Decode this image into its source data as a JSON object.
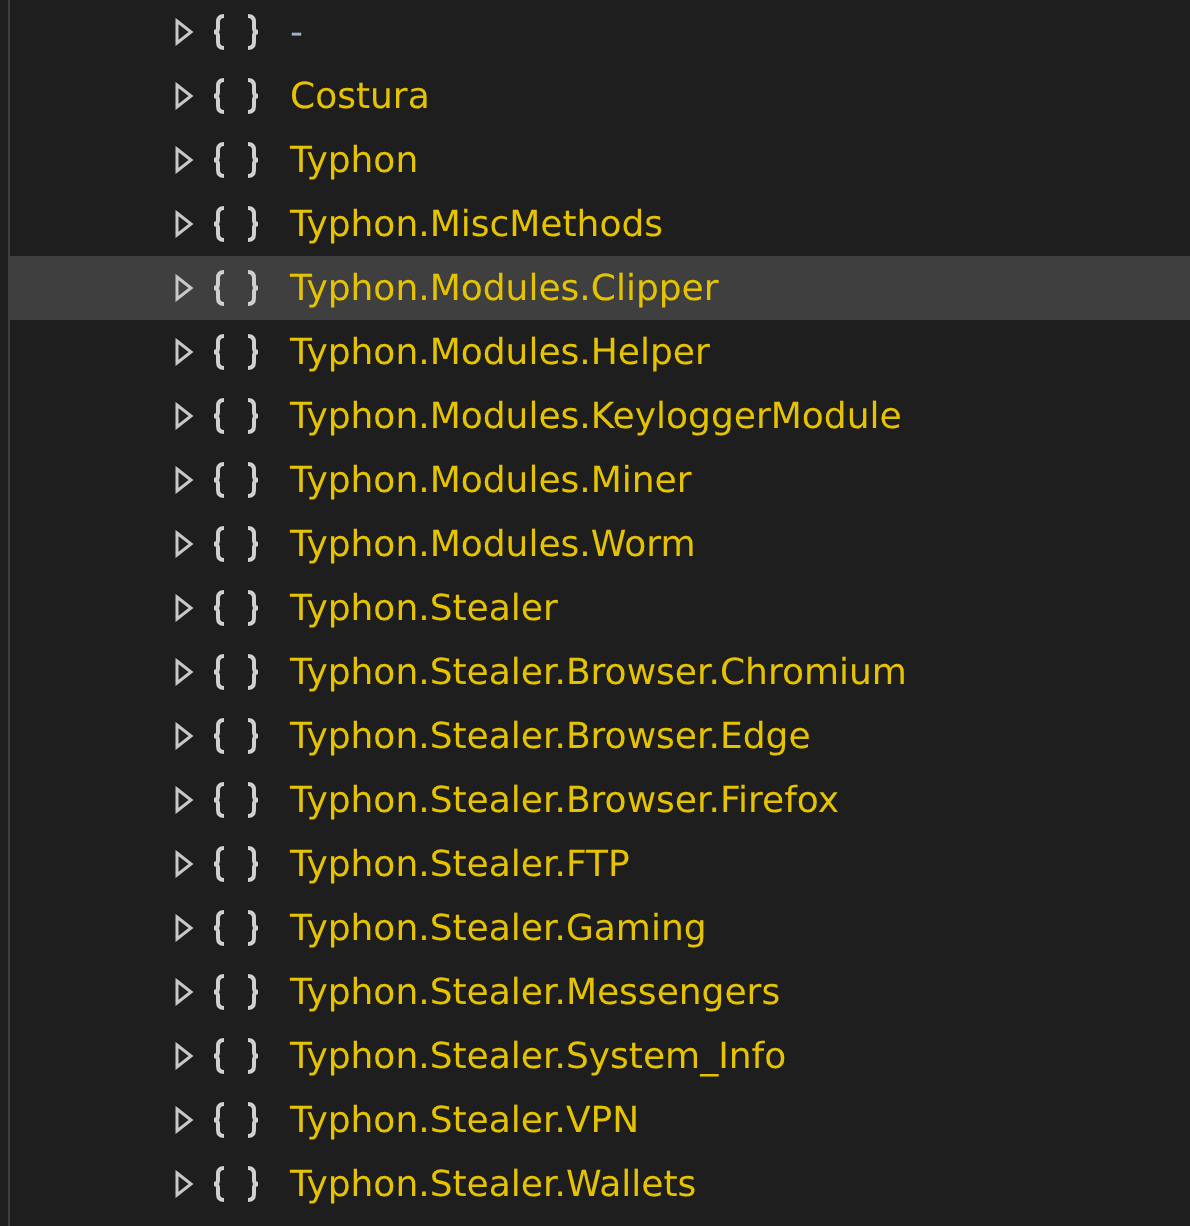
{
  "tree": {
    "items": [
      {
        "label": "-",
        "color": "#9fb3c8",
        "selected": false
      },
      {
        "label": "Costura",
        "color": "#e6c300",
        "selected": false
      },
      {
        "label": "Typhon",
        "color": "#e6c300",
        "selected": false
      },
      {
        "label": "Typhon.MiscMethods",
        "color": "#e6c300",
        "selected": false
      },
      {
        "label": "Typhon.Modules.Clipper",
        "color": "#e6c300",
        "selected": true
      },
      {
        "label": "Typhon.Modules.Helper",
        "color": "#e6c300",
        "selected": false
      },
      {
        "label": "Typhon.Modules.KeyloggerModule",
        "color": "#e6c300",
        "selected": false
      },
      {
        "label": "Typhon.Modules.Miner",
        "color": "#e6c300",
        "selected": false
      },
      {
        "label": "Typhon.Modules.Worm",
        "color": "#e6c300",
        "selected": false
      },
      {
        "label": "Typhon.Stealer",
        "color": "#e6c300",
        "selected": false
      },
      {
        "label": "Typhon.Stealer.Browser.Chromium",
        "color": "#e6c300",
        "selected": false
      },
      {
        "label": "Typhon.Stealer.Browser.Edge",
        "color": "#e6c300",
        "selected": false
      },
      {
        "label": "Typhon.Stealer.Browser.Firefox",
        "color": "#e6c300",
        "selected": false
      },
      {
        "label": "Typhon.Stealer.FTP",
        "color": "#e6c300",
        "selected": false
      },
      {
        "label": "Typhon.Stealer.Gaming",
        "color": "#e6c300",
        "selected": false
      },
      {
        "label": "Typhon.Stealer.Messengers",
        "color": "#e6c300",
        "selected": false
      },
      {
        "label": "Typhon.Stealer.System_Info",
        "color": "#e6c300",
        "selected": false
      },
      {
        "label": "Typhon.Stealer.VPN",
        "color": "#e6c300",
        "selected": false
      },
      {
        "label": "Typhon.Stealer.Wallets",
        "color": "#e6c300",
        "selected": false
      }
    ]
  }
}
